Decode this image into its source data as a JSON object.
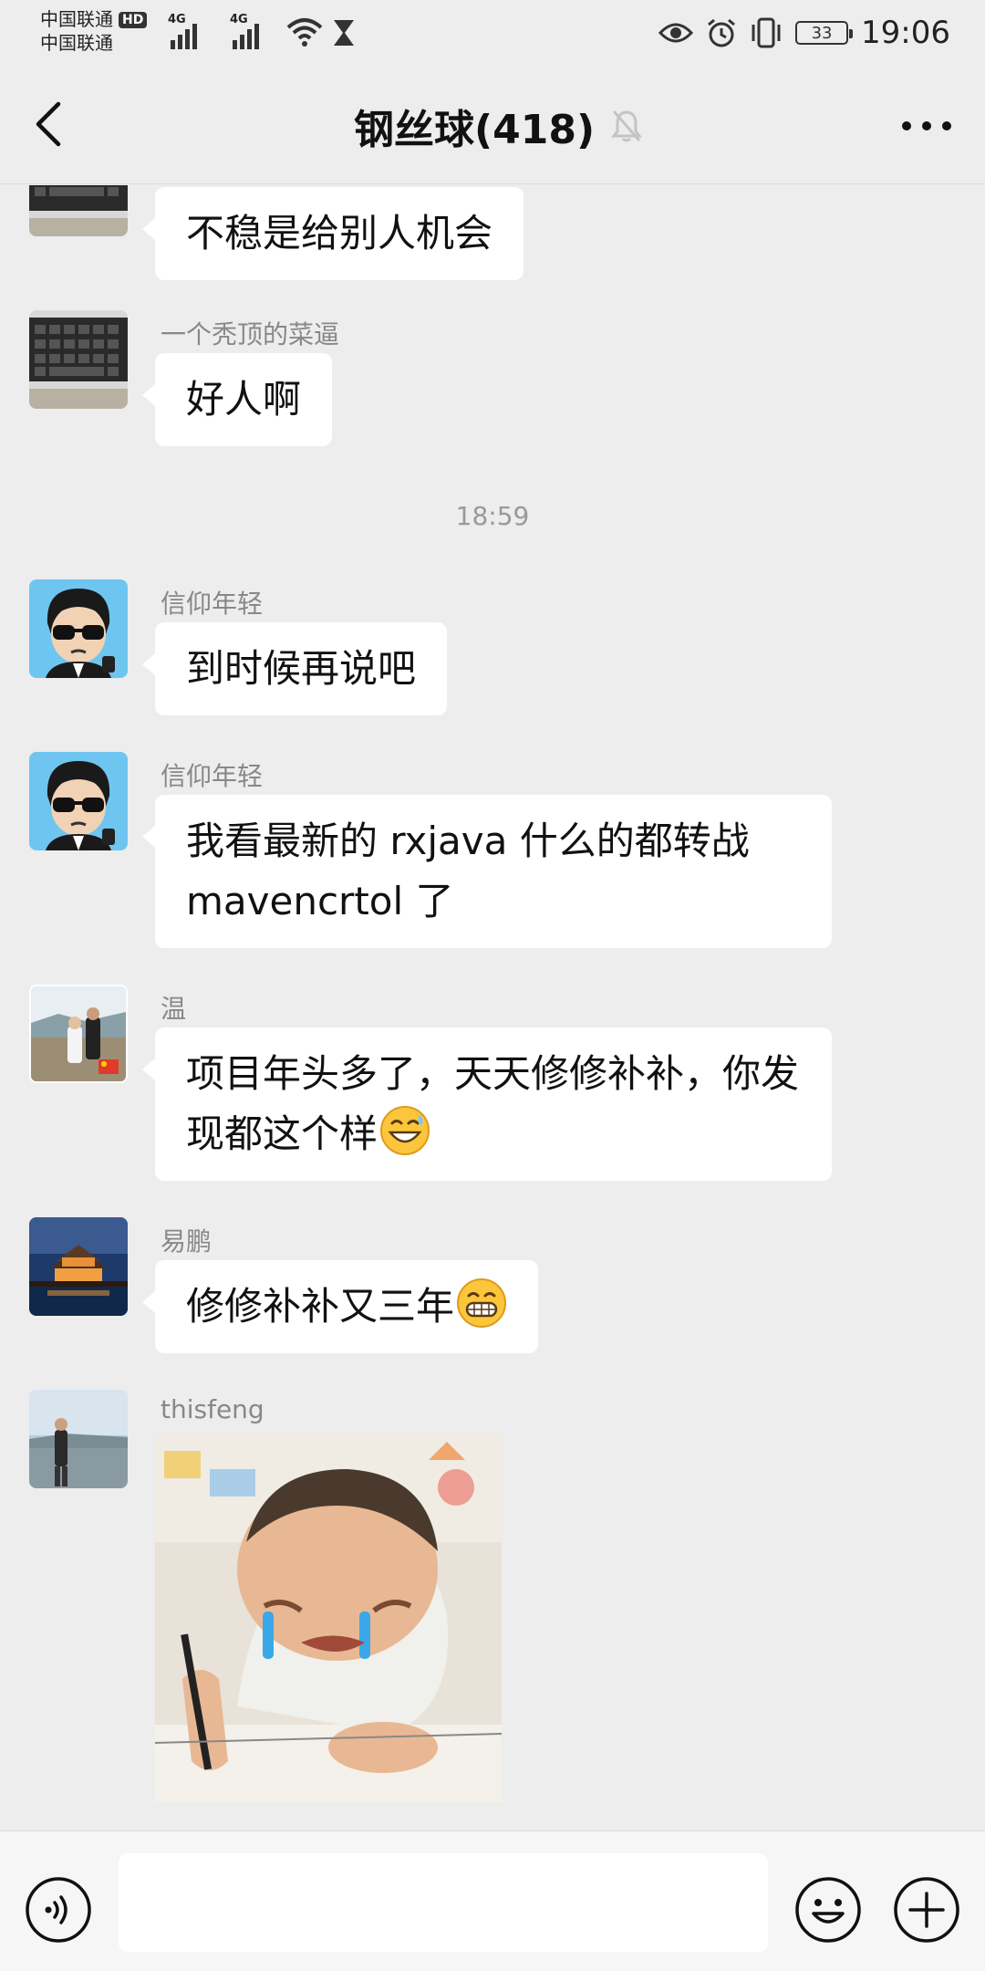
{
  "status_bar": {
    "carrier_line1": "中国联通",
    "hd_badge": "HD",
    "carrier_line2": "中国联通",
    "network1": "4G",
    "network2": "4G",
    "battery": "33",
    "time": "19:06",
    "icons": [
      "signal-icon",
      "wifi-icon",
      "hourglass-icon",
      "eye-icon",
      "alarm-icon",
      "vibrate-icon",
      "battery-icon"
    ]
  },
  "header": {
    "title": "钢丝球(418)",
    "icons": [
      "back-icon",
      "mute-bell-icon",
      "more-icon"
    ]
  },
  "messages": [
    {
      "sender": "",
      "text": "不稳是给别人机会",
      "avatar": "keyboard"
    },
    {
      "sender": "一个秃顶的菜逼",
      "text": "好人啊",
      "avatar": "keyboard"
    },
    {
      "timestamp": "18:59"
    },
    {
      "sender": "信仰年轻",
      "text": "到时候再说吧",
      "avatar": "cartoon"
    },
    {
      "sender": "信仰年轻",
      "text": "我看最新的 rxjava 什么的都转战 mavencrtol 了",
      "avatar": "cartoon"
    },
    {
      "sender": "温",
      "text": "项目年头多了，天天修修补补，你发现都这个样",
      "emoji": "grin-sweat-emoji",
      "avatar": "photo-couple"
    },
    {
      "sender": "易鹏",
      "text": "修修补补又三年",
      "emoji": "grin-emoji",
      "avatar": "night-pagoda"
    },
    {
      "sender": "thisfeng",
      "sticker": "crying-baby-sticker",
      "avatar": "photo-man-lake"
    }
  ],
  "input_bar": {
    "placeholder": "",
    "icons": [
      "voice-icon",
      "emoji-icon",
      "plus-icon"
    ]
  },
  "colors": {
    "background": "#ededed",
    "bubble": "#ffffff",
    "sender_name": "#888888"
  }
}
